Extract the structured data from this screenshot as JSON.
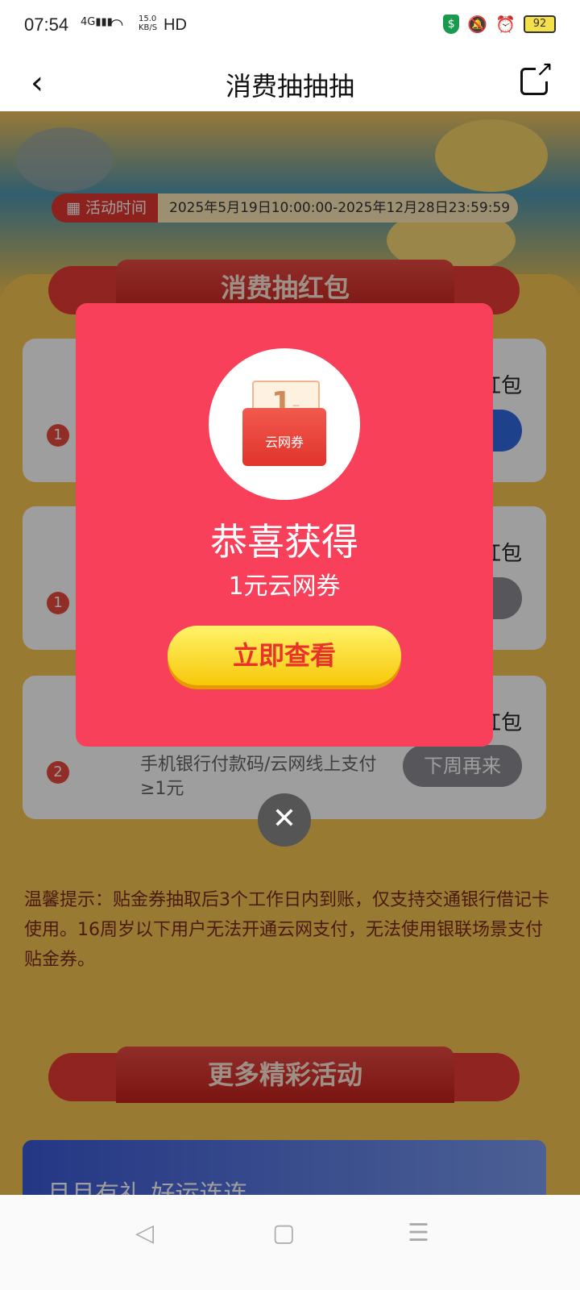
{
  "status_bar": {
    "time": "07:54",
    "network": "4G",
    "speed_value": "15.0",
    "speed_unit": "KB/S",
    "hd": "HD",
    "battery": "92"
  },
  "header": {
    "title": "消费抽抽抽"
  },
  "activity": {
    "time_label": "活动时间",
    "time_range": "2025年5月19日10:00:00-2025年12月28日23:59:59"
  },
  "section1": {
    "title": "消费抽红包"
  },
  "tasks": [
    {
      "num": "1",
      "right_text": "红包",
      "button": ""
    },
    {
      "num": "1",
      "right_text": "红包",
      "button": "来"
    },
    {
      "num": "2",
      "right_text": "红包",
      "button": "下周再来",
      "desc": "手机银行付款码/云网线上支付≥1元"
    }
  ],
  "tips": {
    "text": "温馨提示：贴金券抽取后3个工作日内到账，仅支持交通银行借记卡使用。16周岁以下用户无法开通云网支付，无法使用银联场景支付贴金券。"
  },
  "section2": {
    "title": "更多精彩活动"
  },
  "ad": {
    "text": "月月有礼 好运连连"
  },
  "modal": {
    "coupon_amount": "1",
    "coupon_unit": "元",
    "coupon_name": "云网券",
    "congrats": "恭喜获得",
    "prize": "1元云网券",
    "view_button": "立即查看"
  },
  "colors": {
    "modal_bg": "#f8405a",
    "page_bg": "#f5c44f",
    "button_text": "#e8322a"
  }
}
